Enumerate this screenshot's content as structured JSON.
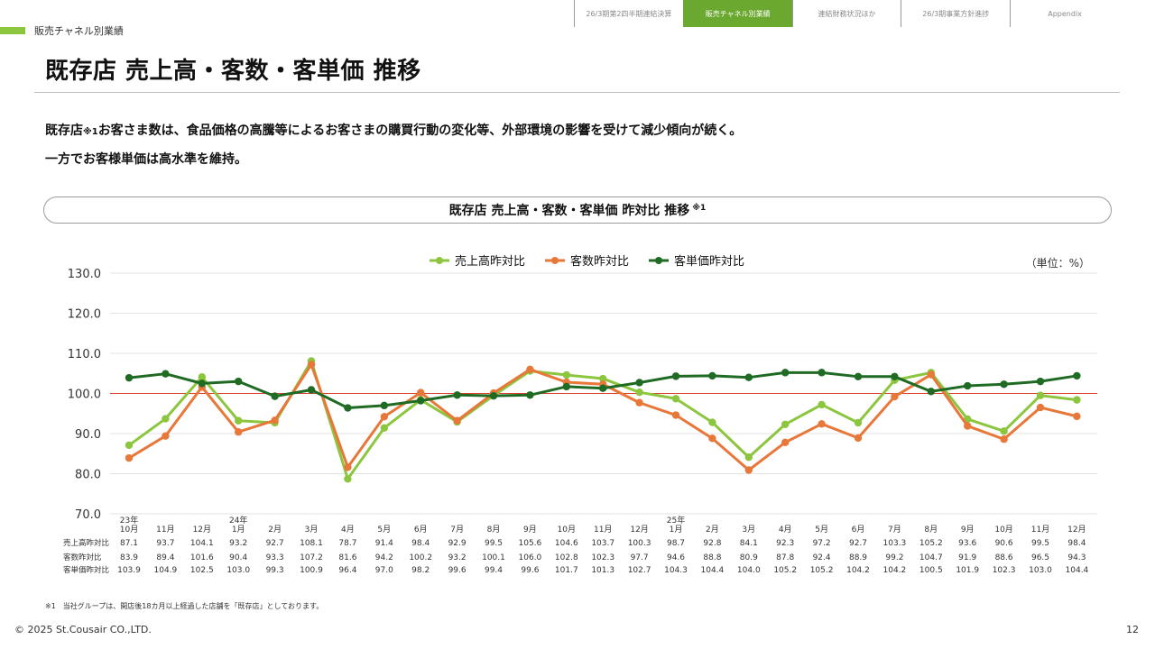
{
  "nav": {
    "tabs": [
      {
        "label": "26/3期第2四半期連結決算",
        "active": false
      },
      {
        "label": "販売チャネル別業績",
        "active": true
      },
      {
        "label": "連結財務状況ほか",
        "active": false
      },
      {
        "label": "26/3期事業方針進捗",
        "active": false
      },
      {
        "label": "Appendix",
        "active": false
      }
    ]
  },
  "section_label": "販売チャネル別業績",
  "page_title": "既存店 売上高・客数・客単価 推移",
  "lead": {
    "line1_pre": "既存店",
    "line1_note": "※1",
    "line1_post": "お客さま数は、食品価格の高騰等によるお客さまの購買行動の変化等、外部環境の影響を受けて減少傾向が続く。",
    "line2": "一方でお客様単価は高水準を維持。"
  },
  "chart_box": {
    "title": "既存店 売上高・客数・客単価 昨対比 推移",
    "note": "※1"
  },
  "chart_data": {
    "type": "line",
    "unit_label": "（単位：%）",
    "ylim": [
      70,
      130
    ],
    "yticks": [
      "130.0",
      "120.0",
      "110.0",
      "100.0",
      "90.0",
      "80.0",
      "70.0"
    ],
    "reference_line": 100,
    "grid": true,
    "legend_position": "top-center",
    "categories": [
      {
        "year": "23年",
        "month": "10月"
      },
      {
        "year": "",
        "month": "11月"
      },
      {
        "year": "",
        "month": "12月"
      },
      {
        "year": "24年",
        "month": "1月"
      },
      {
        "year": "",
        "month": "2月"
      },
      {
        "year": "",
        "month": "3月"
      },
      {
        "year": "",
        "month": "4月"
      },
      {
        "year": "",
        "month": "5月"
      },
      {
        "year": "",
        "month": "6月"
      },
      {
        "year": "",
        "month": "7月"
      },
      {
        "year": "",
        "month": "8月"
      },
      {
        "year": "",
        "month": "9月"
      },
      {
        "year": "",
        "month": "10月"
      },
      {
        "year": "",
        "month": "11月"
      },
      {
        "year": "",
        "month": "12月"
      },
      {
        "year": "25年",
        "month": "1月"
      },
      {
        "year": "",
        "month": "2月"
      },
      {
        "year": "",
        "month": "3月"
      },
      {
        "year": "",
        "month": "4月"
      },
      {
        "year": "",
        "month": "5月"
      },
      {
        "year": "",
        "month": "6月"
      },
      {
        "year": "",
        "month": "7月"
      },
      {
        "year": "",
        "month": "8月"
      },
      {
        "year": "",
        "month": "9月"
      },
      {
        "year": "",
        "month": "10月"
      },
      {
        "year": "",
        "month": "11月"
      },
      {
        "year": "",
        "month": "12月"
      }
    ],
    "series": [
      {
        "name": "売上高昨対比",
        "table_label": "売上高昨対比",
        "color": "#8cc63f",
        "values": [
          "87.1",
          "93.7",
          "104.1",
          "93.2",
          "92.7",
          "108.1",
          "78.7",
          "91.4",
          "98.4",
          "92.9",
          "99.5",
          "105.6",
          "104.6",
          "103.7",
          "100.3",
          "98.7",
          "92.8",
          "84.1",
          "92.3",
          "97.2",
          "92.7",
          "103.3",
          "105.2",
          "93.6",
          "90.6",
          "99.5",
          "98.4"
        ]
      },
      {
        "name": "客数昨対比",
        "table_label": "客数昨対比",
        "color": "#e8773a",
        "values": [
          "83.9",
          "89.4",
          "101.6",
          "90.4",
          "93.3",
          "107.2",
          "81.6",
          "94.2",
          "100.2",
          "93.2",
          "100.1",
          "106.0",
          "102.8",
          "102.3",
          "97.7",
          "94.6",
          "88.8",
          "80.9",
          "87.8",
          "92.4",
          "88.9",
          "99.2",
          "104.7",
          "91.9",
          "88.6",
          "96.5",
          "94.3"
        ]
      },
      {
        "name": "客単価昨対比",
        "table_label": "客単価昨対比",
        "color": "#1f6b24",
        "values": [
          "103.9",
          "104.9",
          "102.5",
          "103.0",
          "99.3",
          "100.9",
          "96.4",
          "97.0",
          "98.2",
          "99.6",
          "99.4",
          "99.6",
          "101.7",
          "101.3",
          "102.7",
          "104.3",
          "104.4",
          "104.0",
          "105.2",
          "105.2",
          "104.2",
          "104.2",
          "100.5",
          "101.9",
          "102.3",
          "103.0",
          "104.4"
        ]
      }
    ],
    "colors": {
      "grid": "#e3e3e3",
      "reference": "#d9412b",
      "text": "#333333"
    }
  },
  "footnote": "※1　当社グループは、開店後18カ月以上経過した店舗を「既存店」としております。",
  "copyright": "© 2025 St.Cousair CO.,LTD.",
  "page_number": "12"
}
